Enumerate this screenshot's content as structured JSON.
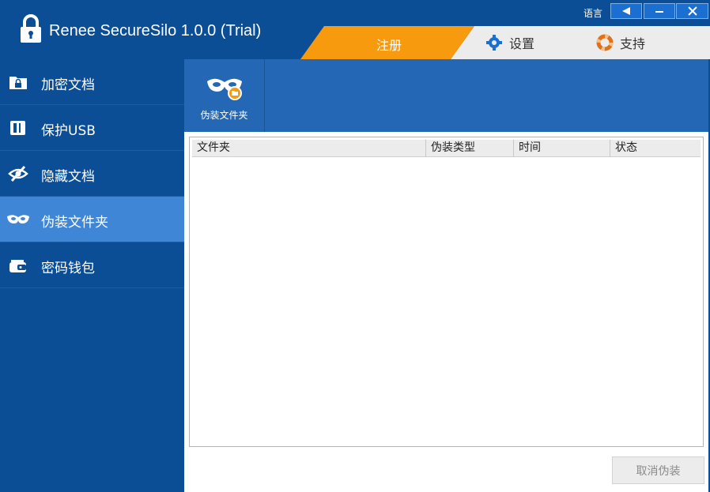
{
  "app": {
    "title": "Renee SecureSilo 1.0.0 (Trial)",
    "language_label": "语言"
  },
  "tabs": {
    "register": "注册",
    "settings": "设置",
    "support": "支持"
  },
  "sidebar": {
    "items": [
      {
        "label": "加密文档",
        "icon": "folder-lock-icon"
      },
      {
        "label": "保护USB",
        "icon": "usb-protect-icon"
      },
      {
        "label": "隐藏文档",
        "icon": "eye-hidden-icon"
      },
      {
        "label": "伪装文件夹",
        "icon": "mask-icon",
        "active": true
      },
      {
        "label": "密码钱包",
        "icon": "wallet-icon"
      }
    ]
  },
  "toolbar": {
    "disguise_folder_label": "伪装文件夹"
  },
  "table": {
    "columns": [
      "文件夹",
      "伪装类型",
      "时间",
      "状态"
    ],
    "rows": []
  },
  "actions": {
    "cancel_disguise": "取消伪装"
  },
  "colors": {
    "primary": "#0b4e96",
    "active": "#3f86d6",
    "accent": "#f79a0d",
    "toolbar": "#2468b5"
  }
}
